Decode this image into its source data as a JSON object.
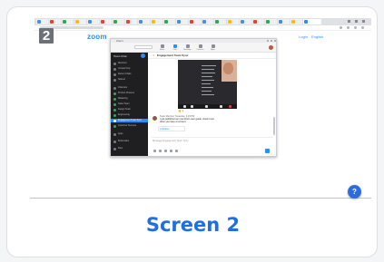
{
  "screenshot": {
    "step_number": "2",
    "logo": "zoom",
    "top_links": [
      "Login",
      "English"
    ],
    "window_title": "Zoom",
    "search_placeholder": "Search",
    "nav_tabs": [
      "Home",
      "Chat",
      "Meetings",
      "Contacts",
      "Apps"
    ],
    "sidebar": {
      "heading": "Team Chat",
      "items": [
        {
          "label": "Mentions",
          "active": false
        },
        {
          "label": "Unread Only",
          "active": false
        },
        {
          "label": "Recent Chats",
          "active": false
        },
        {
          "label": "Starred",
          "active": false
        },
        {
          "label": "Channels",
          "active": false
        },
        {
          "label": "Product Channel",
          "active": false
        },
        {
          "label": "Marketing",
          "active": false
        },
        {
          "label": "Sales Team",
          "active": false
        },
        {
          "label": "Design Team",
          "active": false
        },
        {
          "label": "Engineering",
          "active": false
        },
        {
          "label": "Engagement Team Sync",
          "active": true
        },
        {
          "label": "Customer Success",
          "active": false
        },
        {
          "label": "Apps",
          "active": false
        },
        {
          "label": "Bookmarks",
          "active": false
        },
        {
          "label": "Files",
          "active": false
        }
      ]
    },
    "chat": {
      "channel_name": "Engagement Team Sync",
      "reactions": "👍 1",
      "message_sender": "Team Member  Yesterday, 4:15 PM",
      "message_text": "I just published our new Zoom user guide, check it out when you have a moment.",
      "replies_label": "2 Replies",
      "compose_placeholder": "Message Engagement Team Sync"
    }
  },
  "help_button_label": "?",
  "caption": "Screen 2",
  "colors": {
    "accent": "#2d8cff",
    "caption": "#1f6fe0",
    "sidebar_bg": "#1f1f21",
    "help_button": "#2d6cdf"
  }
}
